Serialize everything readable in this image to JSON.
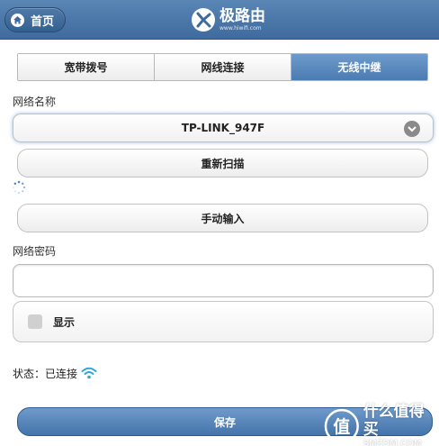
{
  "header": {
    "home_label": "首页",
    "brand_name": "极路由",
    "brand_url": "www.hiwifi.com"
  },
  "tabs": [
    {
      "label": "宽带拨号",
      "active": false
    },
    {
      "label": "网线连接",
      "active": false
    },
    {
      "label": "无线中继",
      "active": true
    }
  ],
  "network": {
    "name_label": "网络名称",
    "selected_ssid": "TP-LINK_947F",
    "rescan_label": "重新扫描",
    "manual_label": "手动输入"
  },
  "password": {
    "label": "网络密码",
    "value": "",
    "show_label": "显示",
    "show_checked": false
  },
  "status": {
    "text": "状态：已连接"
  },
  "save_label": "保存",
  "watermark": {
    "cn": "什么值得买",
    "en": "SMZDM.COM"
  },
  "colors": {
    "header": "#4a76a8",
    "active_tab": "#5b8bc0",
    "wifi": "#2aa7d8"
  }
}
